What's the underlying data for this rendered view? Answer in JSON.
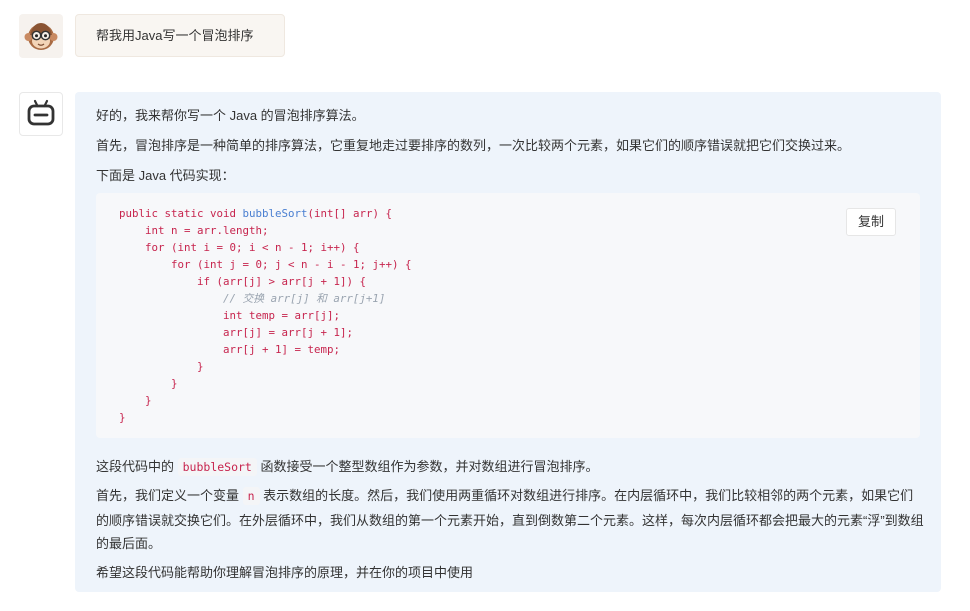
{
  "user": {
    "avatar_icon": "monkey-avatar-icon",
    "message": "帮我用Java写一个冒泡排序"
  },
  "bot": {
    "avatar_icon": "robot-avatar-icon",
    "intro": "好的，我来帮你写一个 Java 的冒泡排序算法。",
    "explain1": "首先，冒泡排序是一种简单的排序算法，它重复地走过要排序的数列，一次比较两个元素，如果它们的顺序错误就把它们交换过来。",
    "code_lead": "下面是 Java 代码实现：",
    "code": {
      "copy_label": "复制",
      "line1_pre": "public static void ",
      "line1_fn": "bubbleSort",
      "line1_post": "(int[] arr) {",
      "line2": "    int n = arr.length;",
      "line3": "    for (int i = 0; i < n - 1; i++) {",
      "line4": "        for (int j = 0; j < n - i - 1; j++) {",
      "line5": "            if (arr[j] > arr[j + 1]) {",
      "line6": "                // 交换 arr[j] 和 arr[j+1]",
      "line7": "                int temp = arr[j];",
      "line8": "                arr[j] = arr[j + 1];",
      "line9": "                arr[j + 1] = temp;",
      "line10": "            }",
      "line11": "        }",
      "line12": "    }",
      "line13": "}"
    },
    "summary_pre": "这段代码中的 ",
    "summary_code": "bubbleSort",
    "summary_post": " 函数接受一个整型数组作为参数，并对数组进行冒泡排序。",
    "detail_pre": "首先，我们定义一个变量 ",
    "detail_code": "n",
    "detail_post": " 表示数组的长度。然后，我们使用两重循环对数组进行排序。在内层循环中，我们比较相邻的两个元素，如果它们的顺序错误就交换它们。在外层循环中，我们从数组的第一个元素开始，直到倒数第二个元素。这样，每次内层循环都会把最大的元素“浮”到数组的最后面。",
    "closing": "希望这段代码能帮助你理解冒泡排序的原理，并在你的项目中使用"
  }
}
